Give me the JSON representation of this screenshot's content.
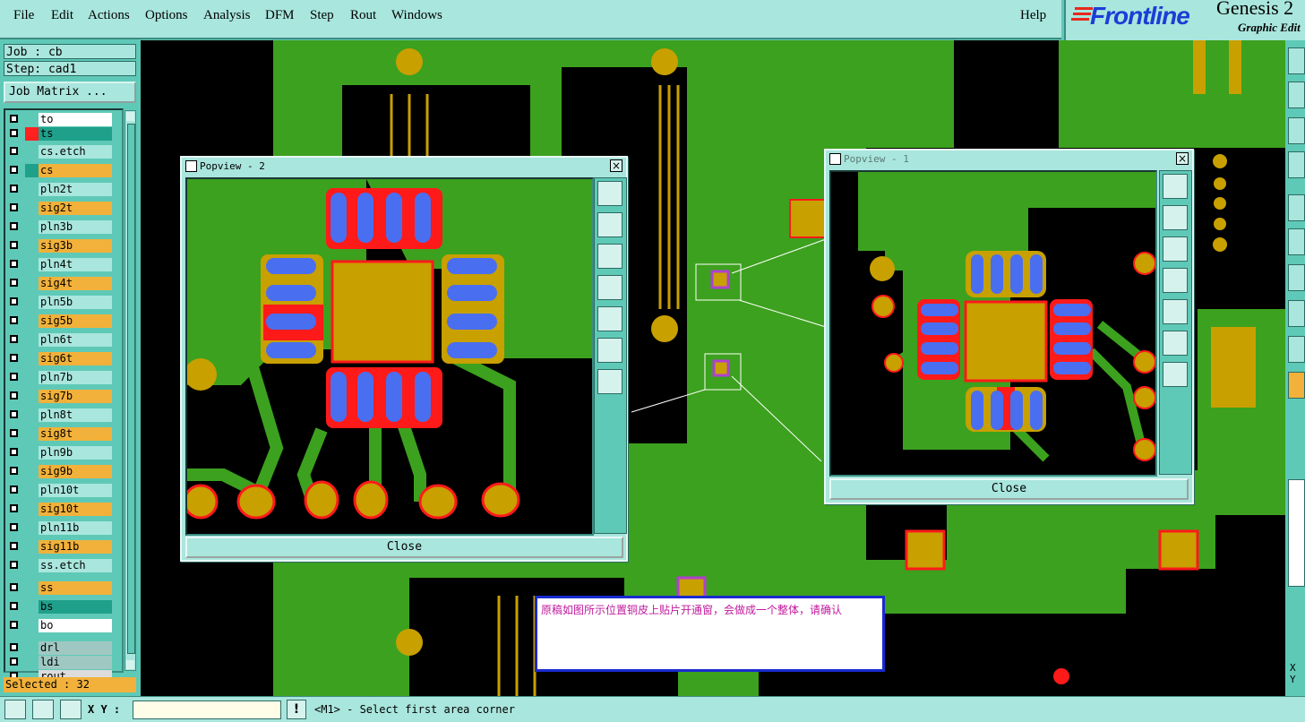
{
  "menubar": {
    "items": [
      "File",
      "Edit",
      "Actions",
      "Options",
      "Analysis",
      "DFM",
      "Step",
      "Rout",
      "Windows"
    ],
    "help": "Help"
  },
  "brand": {
    "logo": "Frontline",
    "product": "Genesis 2",
    "subtitle": "Graphic Edit"
  },
  "job": {
    "job_label": "Job : cb",
    "step_label": "Step: cad1",
    "matrix_button": "Job Matrix ..."
  },
  "layers": [
    {
      "name": "to",
      "color": "#ffffff",
      "swatch": ""
    },
    {
      "name": "ts",
      "color": "#1fa08a",
      "swatch": "#ff2020"
    },
    {
      "name": "cs.etch",
      "color": "#a9e6dd",
      "swatch": ""
    },
    {
      "name": "cs",
      "color": "#f2b13a",
      "swatch": "#1fa08a"
    },
    {
      "name": "pln2t",
      "color": "#a9e6dd",
      "swatch": ""
    },
    {
      "name": "sig2t",
      "color": "#f2b13a",
      "swatch": ""
    },
    {
      "name": "pln3b",
      "color": "#a9e6dd",
      "swatch": ""
    },
    {
      "name": "sig3b",
      "color": "#f2b13a",
      "swatch": ""
    },
    {
      "name": "pln4t",
      "color": "#a9e6dd",
      "swatch": ""
    },
    {
      "name": "sig4t",
      "color": "#f2b13a",
      "swatch": ""
    },
    {
      "name": "pln5b",
      "color": "#a9e6dd",
      "swatch": ""
    },
    {
      "name": "sig5b",
      "color": "#f2b13a",
      "swatch": ""
    },
    {
      "name": "pln6t",
      "color": "#a9e6dd",
      "swatch": ""
    },
    {
      "name": "sig6t",
      "color": "#f2b13a",
      "swatch": ""
    },
    {
      "name": "pln7b",
      "color": "#a9e6dd",
      "swatch": ""
    },
    {
      "name": "sig7b",
      "color": "#f2b13a",
      "swatch": ""
    },
    {
      "name": "pln8t",
      "color": "#a9e6dd",
      "swatch": ""
    },
    {
      "name": "sig8t",
      "color": "#f2b13a",
      "swatch": ""
    },
    {
      "name": "pln9b",
      "color": "#a9e6dd",
      "swatch": ""
    },
    {
      "name": "sig9b",
      "color": "#f2b13a",
      "swatch": ""
    },
    {
      "name": "pln10t",
      "color": "#a9e6dd",
      "swatch": ""
    },
    {
      "name": "sig10t",
      "color": "#f2b13a",
      "swatch": ""
    },
    {
      "name": "pln11b",
      "color": "#a9e6dd",
      "swatch": ""
    },
    {
      "name": "sig11b",
      "color": "#f2b13a",
      "swatch": ""
    },
    {
      "name": "ss.etch",
      "color": "#a9e6dd",
      "swatch": ""
    },
    {
      "name": "ss",
      "color": "#f2b13a",
      "swatch": ""
    },
    {
      "name": "bs",
      "color": "#1fa08a",
      "swatch": ""
    },
    {
      "name": "bo",
      "color": "#ffffff",
      "swatch": ""
    },
    {
      "name": "drl",
      "color": "#a0c8c2",
      "swatch": ""
    },
    {
      "name": "ldi",
      "color": "#a0c8c2",
      "swatch": ""
    },
    {
      "name": "rout",
      "color": "#dcdcdc",
      "swatch": ""
    }
  ],
  "selected": "Selected : 32",
  "popview2": {
    "title": "Popview - 2",
    "close": "Close"
  },
  "popview1": {
    "title": "Popview - 1",
    "close": "Close"
  },
  "note": "原稿如图所示位置铜皮上贴片开通窗，会做成一个整体，请确认",
  "status": {
    "xy_label": "X Y :",
    "message": "<M1> - Select first area corner",
    "xy_side": "X Y"
  },
  "colors": {
    "copper": "#3ca11e",
    "pad": "#c8a000",
    "mask": "#ff1a1a",
    "paste": "#4a6ef0",
    "panel": "#a9e6dd"
  }
}
